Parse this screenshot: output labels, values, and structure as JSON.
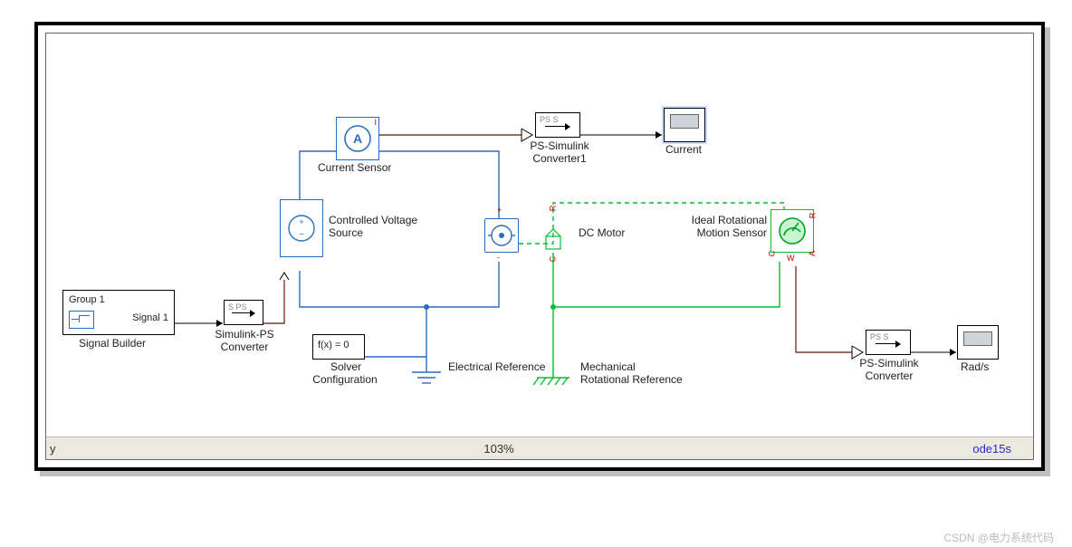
{
  "status_bar": {
    "left": "y",
    "zoom": "103%",
    "solver": "ode15s"
  },
  "watermark": "CSDN @电力系统代码",
  "blocks": {
    "signal_builder": {
      "title": "Group 1",
      "signal": "Signal 1",
      "label": "Signal Builder"
    },
    "sp_conv": {
      "ports": "S PS",
      "label_l1": "Simulink-PS",
      "label_l2": "Converter"
    },
    "cvs": {
      "label_l1": "Controlled Voltage",
      "label_l2": "Source"
    },
    "solver_cfg": {
      "fx": "f(x) = 0",
      "label_l1": "Solver",
      "label_l2": "Configuration"
    },
    "current_sensor": {
      "label": "Current Sensor",
      "port_i": "I"
    },
    "elec_ref": {
      "label": "Electrical Reference"
    },
    "dc_motor": {
      "label": "DC Motor",
      "pr": "R",
      "pc": "C",
      "pplus": "+",
      "pminus": "-"
    },
    "mech_ref": {
      "label_l1": "Mechanical",
      "label_l2": "Rotational Reference"
    },
    "irms": {
      "label_l1": "Ideal Rotational",
      "label_l2": "Motion Sensor",
      "pr": "R",
      "pc": "C",
      "pw": "W",
      "pa": "A"
    },
    "psc1": {
      "ports": "PS S",
      "label_l1": "PS-Simulink",
      "label_l2": "Converter1"
    },
    "psc2": {
      "ports": "PS S",
      "label_l1": "PS-Simulink",
      "label_l2": "Converter"
    },
    "scope_cur": {
      "label": "Current"
    },
    "scope_rad": {
      "label": "Rad/s"
    }
  },
  "colors": {
    "elec": "#2a6cbf",
    "mech": "#00c030",
    "phys": "#7b3b2c",
    "sig": "#000"
  }
}
